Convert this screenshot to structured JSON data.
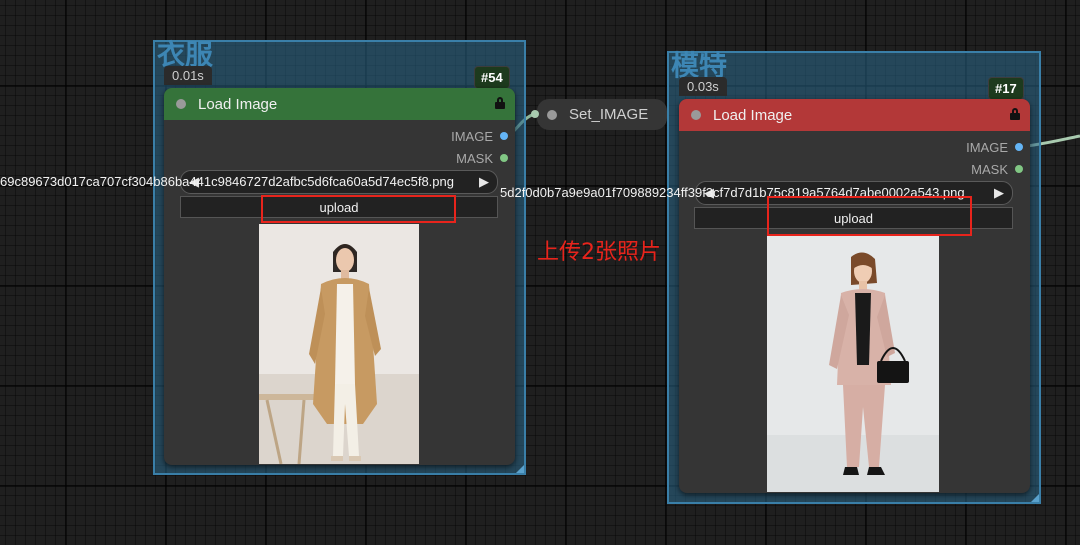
{
  "colors": {
    "group_fill": "#2a688a",
    "green_header": "#35733a",
    "red_header": "#b33838",
    "annotation_red": "#e8241c",
    "image_socket": "#64b5f6",
    "mask_socket": "#81c784"
  },
  "group_left": {
    "title": "衣服",
    "timing": "0.01s",
    "node": {
      "id": "#54",
      "title": "Load Image",
      "outputs": [
        "IMAGE",
        "MASK"
      ],
      "image_file": "69c89673d017ca707cf304b86ba441c9846727d2afbc5d6fca60a5d74ec5f8.png",
      "upload_label": "upload",
      "preview": "woman-in-camel-trench-coat"
    }
  },
  "set_node": {
    "title": "Set_IMAGE"
  },
  "group_right": {
    "title": "模特",
    "timing": "0.03s",
    "node": {
      "id": "#17",
      "title": "Load Image",
      "outputs": [
        "IMAGE",
        "MASK"
      ],
      "image_file": "5d2f0d0b7a9e9a01f709889234ff39f3cf7d7d1b75c819a5764d7abe0002a543.png",
      "upload_label": "upload",
      "preview": "woman-in-pink-suit"
    }
  },
  "annotation": {
    "text": "上传2张照片"
  }
}
